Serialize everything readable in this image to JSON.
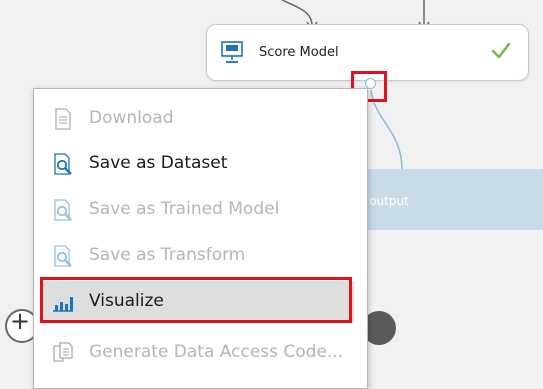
{
  "module": {
    "title": "Score Model",
    "status": "completed",
    "icon": "score-model-icon",
    "status_icon": "check-icon"
  },
  "output_tooltip": {
    "label": "e output"
  },
  "context_menu": {
    "items": [
      {
        "label": "Download",
        "icon": "document-icon",
        "enabled": false
      },
      {
        "label": "Save as Dataset",
        "icon": "magnifier-document-icon",
        "enabled": true
      },
      {
        "label": "Save as Trained Model",
        "icon": "magnifier-document-icon",
        "enabled": false
      },
      {
        "label": "Save as Transform",
        "icon": "magnifier-document-icon",
        "enabled": false
      },
      {
        "label": "Visualize",
        "icon": "bar-chart-icon",
        "enabled": true,
        "selected": true
      },
      {
        "label": "Generate Data Access Code...",
        "icon": "copy-documents-icon",
        "enabled": false
      }
    ]
  },
  "colors": {
    "canvas": "#f1f1f1",
    "highlight": "#e3111d",
    "accent_blue": "#1e73b8",
    "success": "#7ab648",
    "port": "#8bbbd7"
  },
  "nodes": {
    "add_node_symbol": "+"
  }
}
